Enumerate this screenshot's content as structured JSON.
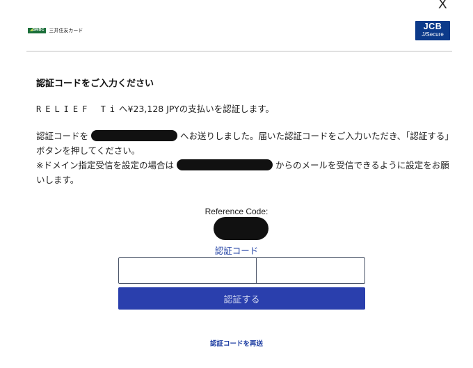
{
  "window": {
    "close_label": "X"
  },
  "header": {
    "issuer_badge": "SMBC",
    "issuer_name": "三井住友カード",
    "scheme_line1": "JCB",
    "scheme_line2": "J/Secure"
  },
  "main": {
    "heading": "認証コードをご入力ください",
    "payment": {
      "merchant": "RELIEF Ti",
      "text": "へ¥23,128 JPYの支払いを認証します。"
    },
    "notice": {
      "part1": "認証コードを",
      "part2": "へお送りしました。届いた認証コードをご入力いただき、「認証する」ボタンを押してください。",
      "part3": "※ドメイン指定受信を設定の場合は",
      "part4": "からのメールを受信できるように設定をお願いします。"
    },
    "reference_label": "Reference Code:",
    "code_label": "認証コード",
    "code_input_1": "",
    "code_input_2": "",
    "submit_label": "認証する",
    "resend_label": "認証コードを再送"
  },
  "colors": {
    "accent": "#2a3fad",
    "link": "#1f3fa3",
    "issuer_green": "#1b6f3a",
    "scheme_blue": "#0c3a8a"
  }
}
